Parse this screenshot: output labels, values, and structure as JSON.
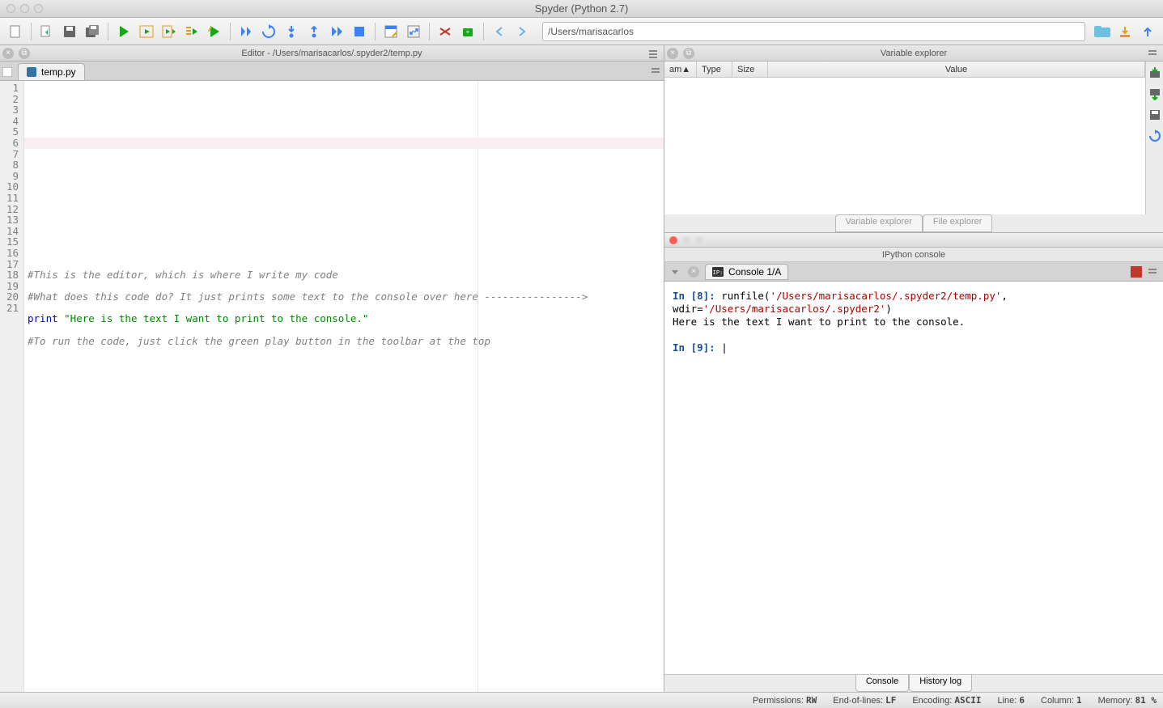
{
  "window": {
    "title": "Spyder (Python 2.7)"
  },
  "toolbar": {
    "path": "/Users/marisacarlos"
  },
  "editor": {
    "pane_title": "Editor - /Users/marisacarlos/.spyder2/temp.py",
    "tab_label": "temp.py",
    "current_line": 6,
    "lines": [
      {
        "n": 1,
        "t": ""
      },
      {
        "n": 2,
        "t": ""
      },
      {
        "n": 3,
        "t": ""
      },
      {
        "n": 4,
        "t": ""
      },
      {
        "n": 5,
        "t": ""
      },
      {
        "n": 6,
        "t": ""
      },
      {
        "n": 7,
        "t": ""
      },
      {
        "n": 8,
        "t": ""
      },
      {
        "n": 9,
        "t": ""
      },
      {
        "n": 10,
        "t": ""
      },
      {
        "n": 11,
        "t": ""
      },
      {
        "n": 12,
        "t": ""
      },
      {
        "n": 13,
        "t": ""
      },
      {
        "n": 14,
        "t": ""
      },
      {
        "n": 15,
        "t": "#This is the editor, which is where I write my code",
        "cls": "c-comment"
      },
      {
        "n": 16,
        "t": ""
      },
      {
        "n": 17,
        "t": "#What does this code do? It just prints some text to the console over here ---------------->",
        "cls": "c-comment"
      },
      {
        "n": 18,
        "t": ""
      },
      {
        "n": 19,
        "parts": [
          {
            "t": "print ",
            "cls": "c-kw"
          },
          {
            "t": "\"Here is the text I want to print to the console.\"",
            "cls": "c-str"
          }
        ]
      },
      {
        "n": 20,
        "t": ""
      },
      {
        "n": 21,
        "t": "#To run the code, just click the green play button in the toolbar at the top",
        "cls": "c-comment"
      }
    ]
  },
  "var_explorer": {
    "title": "Variable explorer",
    "cols": [
      "am",
      "Type",
      "Size",
      "Value"
    ],
    "tabs": [
      "Variable explorer",
      "File explorer"
    ]
  },
  "ipython": {
    "title": "IPython console",
    "tab_label": "Console 1/A",
    "output_prompt_in": "In [8]: ",
    "output_cmd_pre": "runfile(",
    "output_cmd_path1": "'/Users/marisacarlos/.spyder2/temp.py'",
    "output_cmd_mid": ", wdir=",
    "output_cmd_path2": "'/Users/marisacarlos/.spyder2'",
    "output_cmd_post": ")",
    "output_text": "Here is the text I want to print to the console.",
    "next_prompt": "In [9]: ",
    "bottom_tabs": [
      "Console",
      "History log"
    ]
  },
  "status": {
    "perm_label": "Permissions:",
    "perm": "RW",
    "eol_label": "End-of-lines:",
    "eol": "LF",
    "enc_label": "Encoding:",
    "enc": "ASCII",
    "line_label": "Line:",
    "line": "6",
    "col_label": "Column:",
    "col": "1",
    "mem_label": "Memory:",
    "mem": "81 %"
  }
}
